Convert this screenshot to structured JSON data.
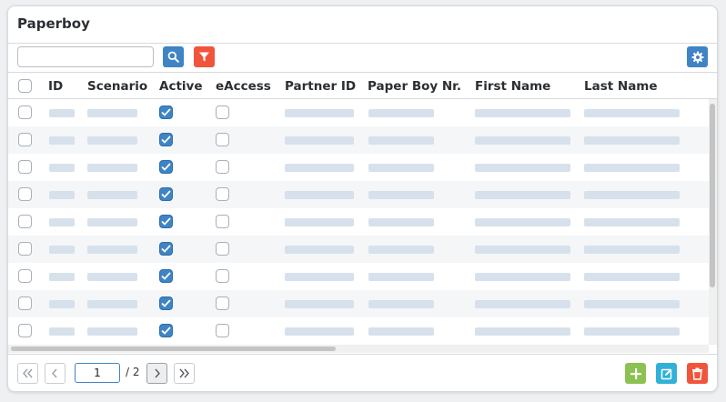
{
  "panel": {
    "title": "Paperboy"
  },
  "toolbar": {
    "search_value": "",
    "search_icon": "search-icon",
    "filter_icon": "filter-icon",
    "settings_icon": "gear-icon"
  },
  "table": {
    "columns": [
      "ID",
      "Scenario",
      "Active",
      "eAccess",
      "Partner ID",
      "Paper Boy Nr.",
      "First Name",
      "Last Name"
    ],
    "rows": [
      {
        "selected": false,
        "active": true,
        "eaccess": false
      },
      {
        "selected": false,
        "active": true,
        "eaccess": false
      },
      {
        "selected": false,
        "active": true,
        "eaccess": false
      },
      {
        "selected": false,
        "active": true,
        "eaccess": false
      },
      {
        "selected": false,
        "active": true,
        "eaccess": false
      },
      {
        "selected": false,
        "active": true,
        "eaccess": false
      },
      {
        "selected": false,
        "active": true,
        "eaccess": false
      },
      {
        "selected": false,
        "active": true,
        "eaccess": false
      },
      {
        "selected": false,
        "active": true,
        "eaccess": false
      }
    ]
  },
  "pager": {
    "current_page": "1",
    "total_label": "/ 2"
  },
  "actions": {
    "add_icon": "plus-icon",
    "edit_icon": "edit-icon",
    "delete_icon": "trash-icon"
  },
  "colors": {
    "primary": "#3f84c5",
    "danger": "#f0553c",
    "success": "#8cc252",
    "info": "#31b1d8"
  }
}
